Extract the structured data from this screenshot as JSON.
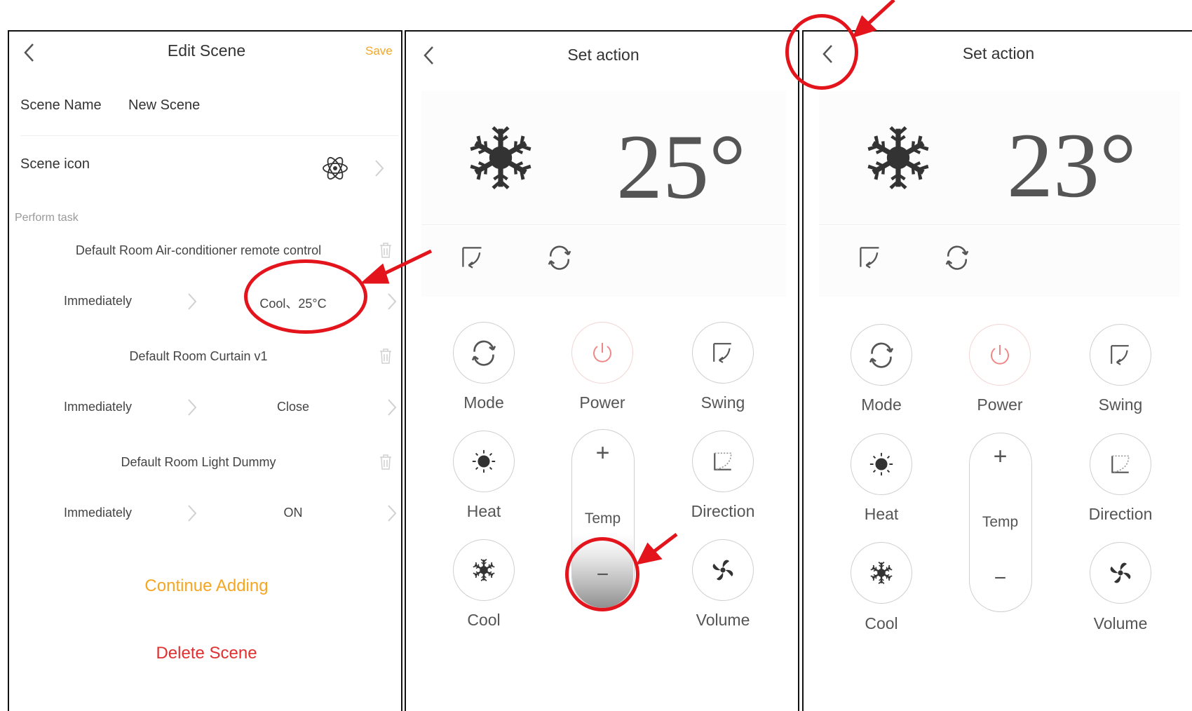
{
  "edit_scene": {
    "title": "Edit Scene",
    "save_label": "Save",
    "scene_name_label": "Scene Name",
    "scene_name_value": "New Scene",
    "scene_icon_label": "Scene icon",
    "perform_task_label": "Perform task",
    "tasks": [
      {
        "device": "Default Room Air-conditioner remote control",
        "timing": "Immediately",
        "action": "Cool、25°C"
      },
      {
        "device": "Default Room Curtain v1",
        "timing": "Immediately",
        "action": "Close"
      },
      {
        "device": "Default Room Light Dummy",
        "timing": "Immediately",
        "action": "ON"
      }
    ],
    "continue_label": "Continue Adding",
    "delete_label": "Delete Scene"
  },
  "set_action_a": {
    "title": "Set action",
    "temperature": "25°",
    "buttons": {
      "mode": "Mode",
      "power": "Power",
      "swing": "Swing",
      "heat": "Heat",
      "temp": "Temp",
      "direction": "Direction",
      "cool": "Cool",
      "volume": "Volume"
    },
    "plus": "+",
    "minus": "−"
  },
  "set_action_b": {
    "title": "Set action",
    "temperature": "23°",
    "buttons": {
      "mode": "Mode",
      "power": "Power",
      "swing": "Swing",
      "heat": "Heat",
      "temp": "Temp",
      "direction": "Direction",
      "cool": "Cool",
      "volume": "Volume"
    },
    "plus": "+",
    "minus": "−"
  },
  "colors": {
    "accent_orange": "#f5a623",
    "danger_red": "#e03030",
    "annotation_red": "#e3141b",
    "icon_dark": "#333333"
  }
}
